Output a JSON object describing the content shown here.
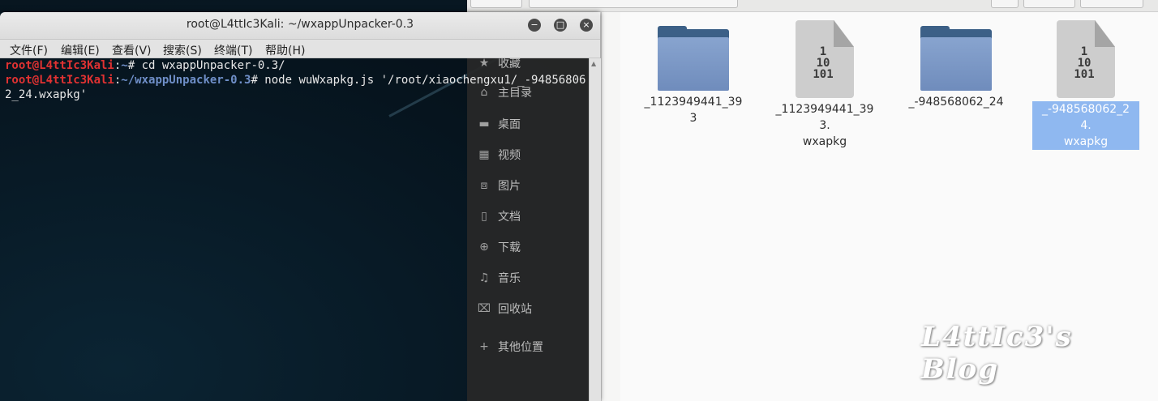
{
  "terminal": {
    "title": "root@L4ttIc3Kali: ~/wxappUnpacker-0.3",
    "window_buttons": {
      "minimize": "−",
      "maximize": "□",
      "close": "×"
    },
    "menu": [
      "文件(F)",
      "编辑(E)",
      "查看(V)",
      "搜索(S)",
      "终端(T)",
      "帮助(H)"
    ],
    "lines": [
      {
        "user": "root@L4ttIc3Kali",
        "sep": ":",
        "path": "~",
        "cmd": "# cd wxappUnpacker-0.3/"
      },
      {
        "user": "root@L4ttIc3Kali",
        "sep": ":",
        "path": "~/wxappUnpacker-0.3",
        "cmd": "# node wuWxapkg.js '/root/xiaochengxu1/_-948568062_24.wxapkg'"
      }
    ]
  },
  "sidebar": {
    "items": [
      {
        "label": "收藏",
        "icon": "star-icon"
      },
      {
        "label": "主目录",
        "icon": "home-icon"
      },
      {
        "label": "桌面",
        "icon": "desktop-icon"
      },
      {
        "label": "视频",
        "icon": "video-icon"
      },
      {
        "label": "图片",
        "icon": "pictures-icon"
      },
      {
        "label": "文档",
        "icon": "document-icon"
      },
      {
        "label": "下载",
        "icon": "download-icon"
      },
      {
        "label": "音乐",
        "icon": "music-icon"
      },
      {
        "label": "回收站",
        "icon": "trash-icon"
      },
      {
        "label": "其他位置",
        "icon": "plus-icon"
      }
    ]
  },
  "files": [
    {
      "name": "_1123949441_393",
      "type": "folder",
      "selected": false
    },
    {
      "name": "_1123949441_393.wxapkg",
      "type": "binary",
      "selected": false,
      "line1": "_1123949441_393.",
      "line2": "wxapkg"
    },
    {
      "name": "_-948568062_24",
      "type": "folder",
      "selected": false
    },
    {
      "name": "_-948568062_24.wxapkg",
      "type": "binary",
      "selected": true,
      "line1": "_-948568062_24.",
      "line2": "wxapkg"
    }
  ],
  "binary_glyph": [
    "1",
    "10",
    "101"
  ],
  "watermark": "L4ttIc3's Blog",
  "colors": {
    "prompt_user": "#e03232",
    "prompt_path": "#6f8fc8",
    "selection": "#8fb8f0",
    "folder": "#6f8cbc"
  }
}
